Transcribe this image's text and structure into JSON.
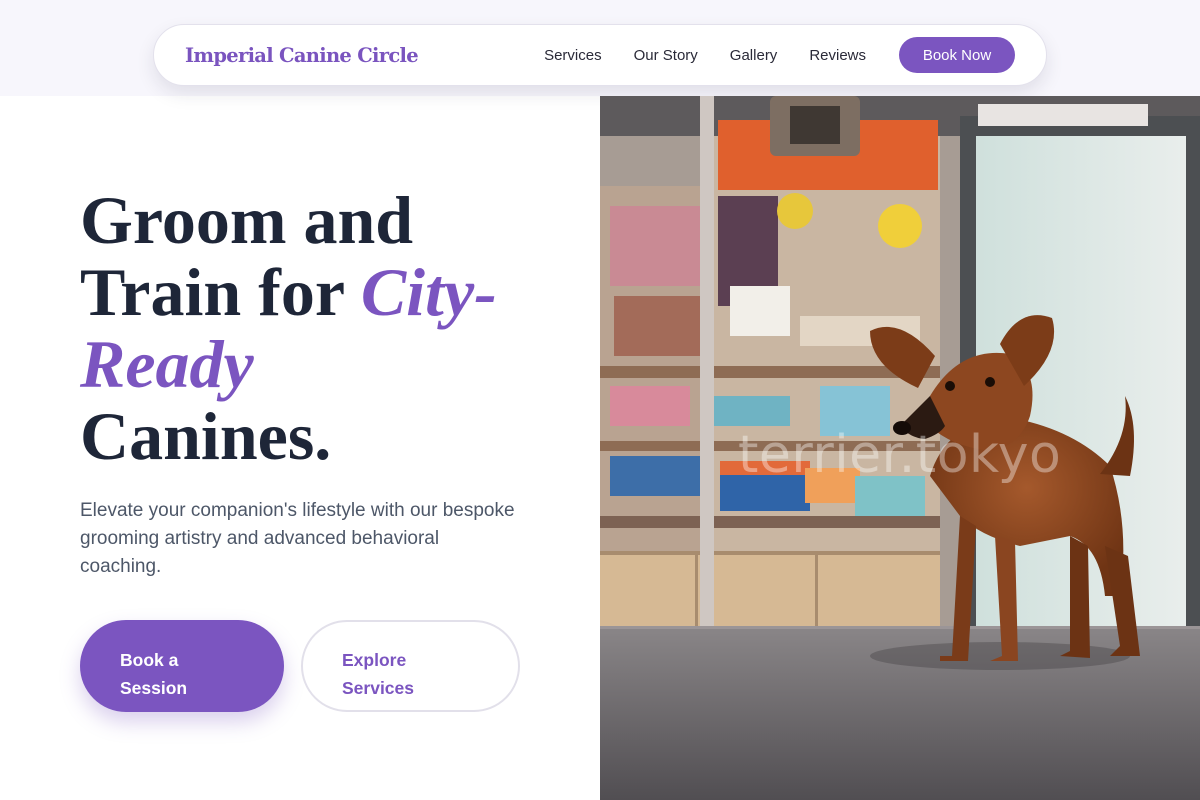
{
  "brand": {
    "name": "Imperial Canine Circle"
  },
  "nav": {
    "links": [
      "Services",
      "Our Story",
      "Gallery",
      "Reviews"
    ],
    "cta": "Book Now"
  },
  "hero": {
    "headline_line1": "Groom and",
    "headline_line2_plain": "Train for ",
    "headline_accent": "City-Ready",
    "headline_line4": "Canines.",
    "subtitle": "Elevate your companion's lifestyle with our bespoke grooming artistry and advanced behavioral coaching.",
    "primary_button": "Book a Session",
    "secondary_button": "Explore Services"
  },
  "photo": {
    "watermark": "terrier.tokyo",
    "subject": "brown terrier dog standing in a pet shop"
  },
  "colors": {
    "accent": "#7b55c0",
    "heading": "#1e2638",
    "body_text": "#4d5768",
    "band": "#f7f6fc"
  }
}
